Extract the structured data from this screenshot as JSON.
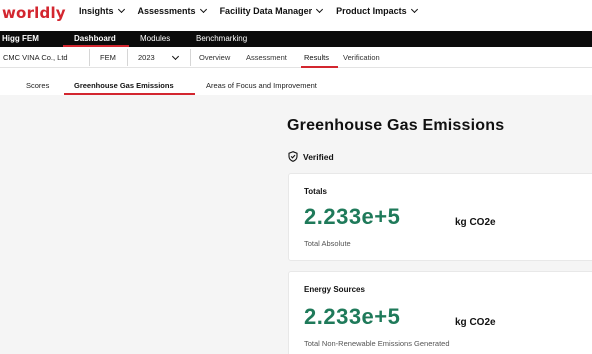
{
  "brand": "worldly",
  "top_menu": [
    {
      "label": "Insights"
    },
    {
      "label": "Assessments"
    },
    {
      "label": "Facility Data Manager"
    },
    {
      "label": "Product Impacts"
    }
  ],
  "module_bar": {
    "brand": "Higg FEM",
    "tabs": [
      "Dashboard",
      "Modules",
      "Benchmarking"
    ],
    "active": "Dashboard"
  },
  "sub_bar": {
    "facility": "CMC VINA Co., Ltd",
    "module": "FEM",
    "year": "2023",
    "tabs": [
      "Overview",
      "Assessment",
      "Results",
      "Verification"
    ],
    "active": "Results"
  },
  "result_tabs": {
    "items": [
      "Scores",
      "Greenhouse Gas Emissions",
      "Areas of Focus and Improvement"
    ],
    "active": "Greenhouse Gas Emissions"
  },
  "page": {
    "title": "Greenhouse Gas Emissions",
    "verified_label": "Verified"
  },
  "cards": [
    {
      "title": "Totals",
      "value": "2.233e+5",
      "unit": "kg CO2e",
      "caption": "Total Absolute"
    },
    {
      "title": "Energy Sources",
      "value": "2.233e+5",
      "unit": "kg CO2e",
      "caption": "Total Non-Renewable Emissions Generated"
    }
  ],
  "colors": {
    "brand_red": "#d3262f",
    "value_green": "#1f7a5a",
    "bar_black": "#0b0b0b"
  }
}
